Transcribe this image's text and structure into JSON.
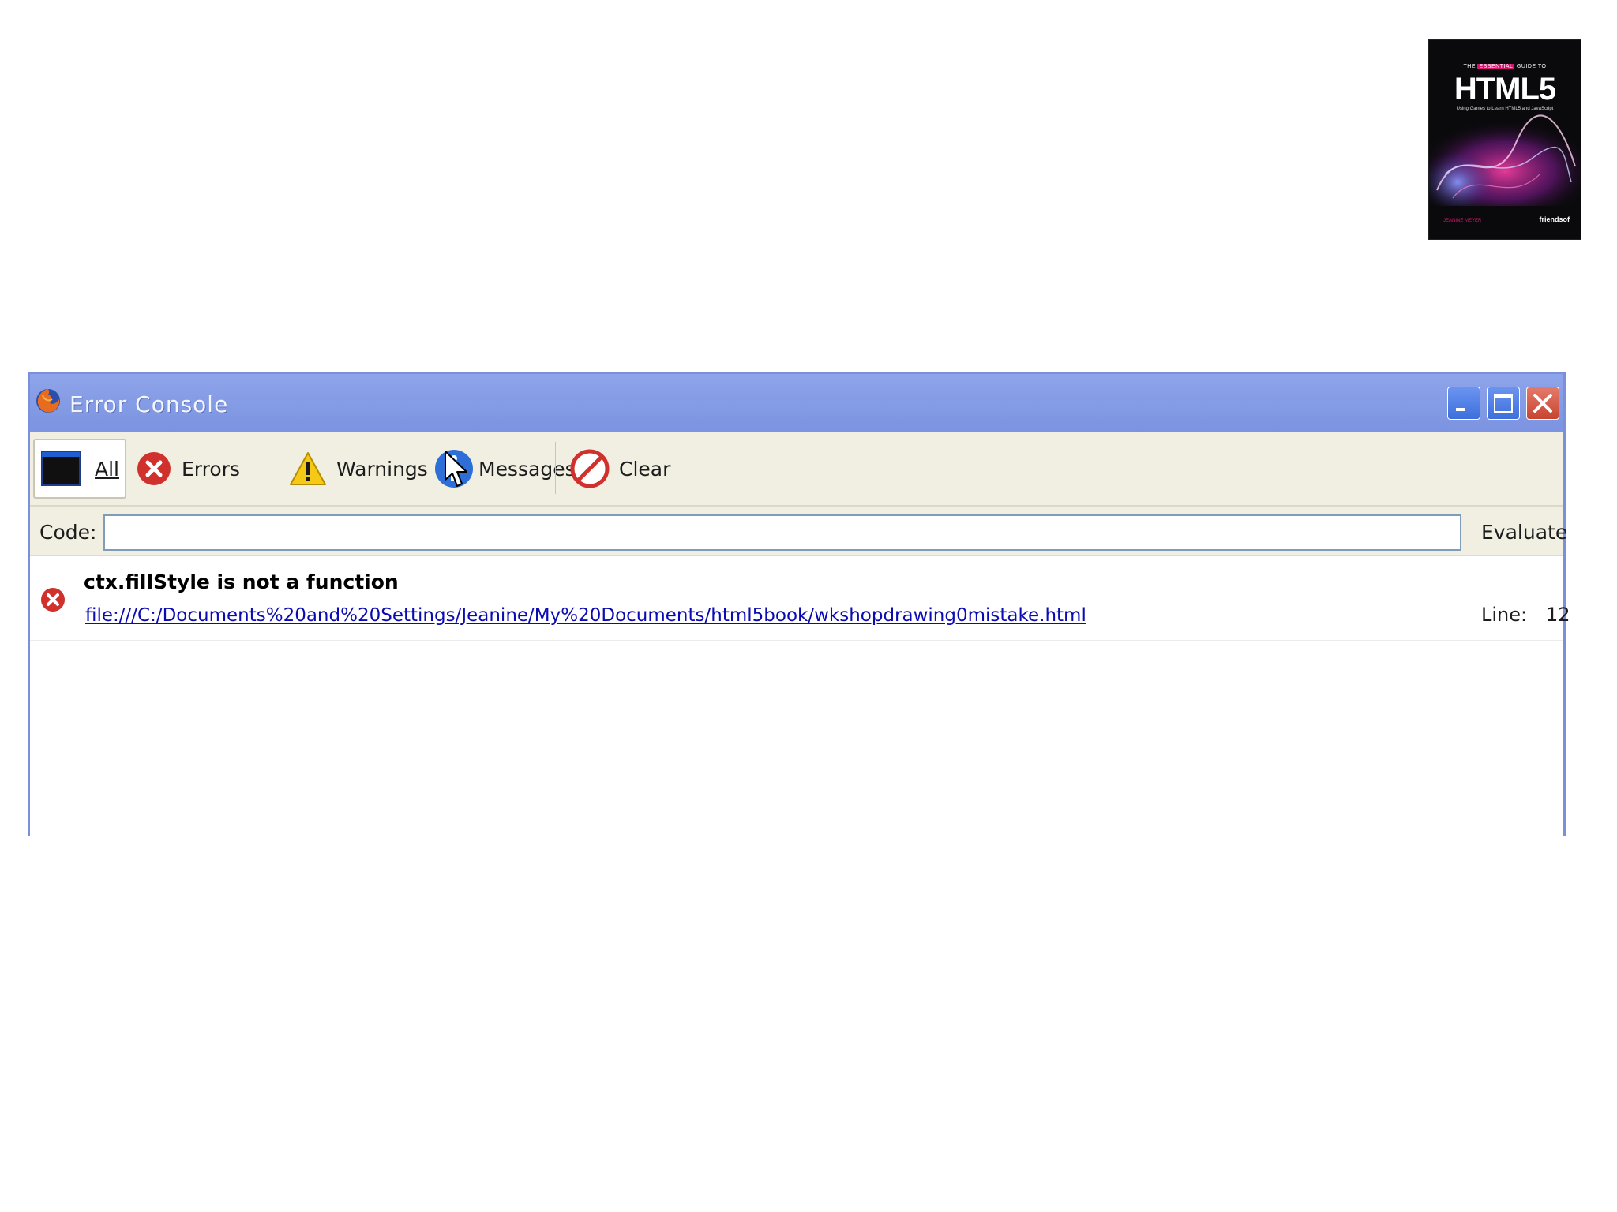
{
  "book": {
    "banner_pre": "THE",
    "banner_highlight": "ESSENTIAL",
    "banner_post": "GUIDE TO",
    "title": "HTML5",
    "subtitle": "Using Games to Learn HTML5 and JavaScript",
    "author": "JEANINE MEYER",
    "publisher": "friendsof"
  },
  "window": {
    "title": "Error Console",
    "app_icon": "firefox-icon",
    "controls": {
      "minimize": "minimize-icon",
      "maximize": "maximize-icon",
      "close": "close-icon"
    }
  },
  "toolbar": {
    "all_label": "All",
    "errors_label": "Errors",
    "warnings_label": "Warnings",
    "messages_label": "Messages",
    "clear_label": "Clear"
  },
  "code_row": {
    "label": "Code:",
    "value": "",
    "evaluate_label": "Evaluate"
  },
  "entries": [
    {
      "message": "ctx.fillStyle is not a function",
      "source": "file:///C:/Documents%20and%20Settings/Jeanine/My%20Documents/html5book/wkshopdrawing0mistake.html",
      "line_label": "Line:",
      "line": "12"
    }
  ],
  "colors": {
    "titlebar": "#7b93e1",
    "toolbar_bg": "#f1efe2",
    "link": "#0b0bb3",
    "error_red": "#d0312d",
    "book_accent": "#d6156f"
  }
}
